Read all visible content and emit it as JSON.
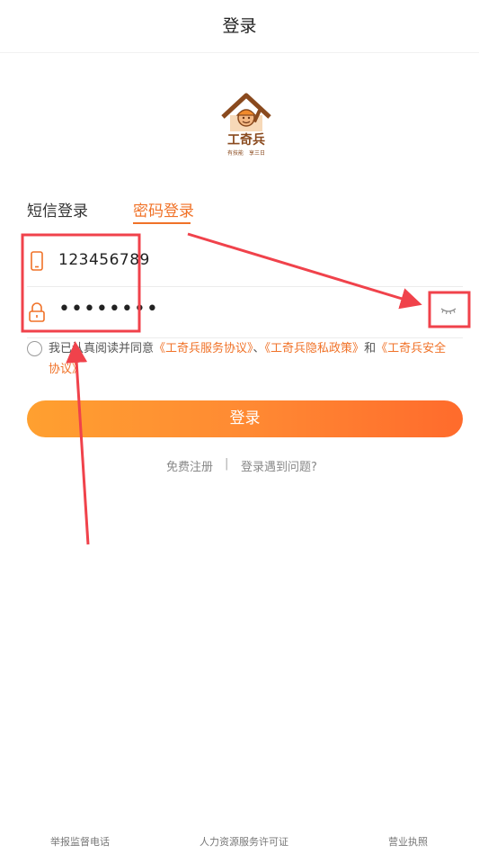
{
  "header": {
    "title": "登录"
  },
  "brand": {
    "name": "工奇兵",
    "slogan": "有技能　享三日"
  },
  "tabs": [
    {
      "label": "短信登录",
      "active": false
    },
    {
      "label": "密码登录",
      "active": true
    }
  ],
  "form": {
    "phone": {
      "value": "123456789",
      "icon": "phone-icon"
    },
    "password": {
      "value": "••••••••",
      "icon": "lock-icon",
      "toggle_icon": "eye-closed-icon"
    }
  },
  "agreement": {
    "text1": "我已认真阅读并同意",
    "link1": "《工奇兵服务协议》",
    "sep1": "、",
    "link2": "《工奇兵隐私政策》",
    "and": "和",
    "link3": "《工奇兵安全协议》",
    "checked": false
  },
  "login_button": "登录",
  "links": {
    "register": "免费注册",
    "separator": "|",
    "problem": "登录遇到问题?"
  },
  "footer": {
    "report": "举报监督电话",
    "license_hr": "人力资源服务许可证",
    "license_biz": "营业执照"
  },
  "colors": {
    "accent": "#f07228",
    "button_start": "#ffa030",
    "button_end": "#ff6b2c",
    "annotation": "#f0424b"
  }
}
